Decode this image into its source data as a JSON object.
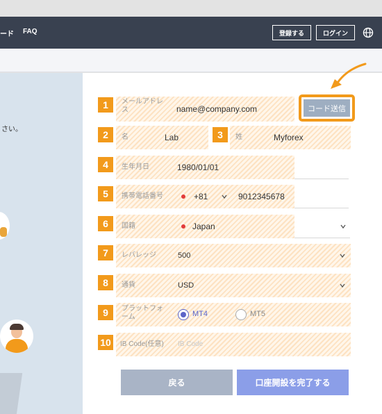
{
  "nav": {
    "link_partial": "ード",
    "faq": "FAQ",
    "register": "登録する",
    "login": "ログイン",
    "globe_icon": "globe-icon"
  },
  "left": {
    "instruction_fragment": "さい。"
  },
  "form": {
    "email": {
      "num": "1",
      "label": "メールアドレス",
      "value": "name@company.com"
    },
    "send_code": "コード送信",
    "first_name": {
      "num": "2",
      "label": "名",
      "value": "Lab"
    },
    "last_name": {
      "num": "3",
      "label": "姓",
      "value": "Myforex"
    },
    "birthdate": {
      "num": "4",
      "label": "生年月日",
      "value": "1980/01/01"
    },
    "phone": {
      "num": "5",
      "label": "携帯電話番号",
      "code": "+81",
      "value": "9012345678"
    },
    "nationality": {
      "num": "6",
      "label": "国籍",
      "value": "Japan"
    },
    "leverage": {
      "num": "7",
      "label": "レバレッジ",
      "value": "500"
    },
    "currency": {
      "num": "8",
      "label": "通貨",
      "value": "USD"
    },
    "platform": {
      "num": "9",
      "label": "プラットフォーム",
      "option1": "MT4",
      "option2": "MT5",
      "selected": "MT4"
    },
    "ib_code": {
      "num": "10",
      "label": "IB Code(任意)",
      "placeholder": "IB Code"
    }
  },
  "buttons": {
    "back": "戻る",
    "complete": "口座開設を完了する"
  },
  "colors": {
    "accent": "#f29a1b",
    "nav": "#394150",
    "primary": "#8b9ee8",
    "secondary": "#a9b4c6"
  }
}
